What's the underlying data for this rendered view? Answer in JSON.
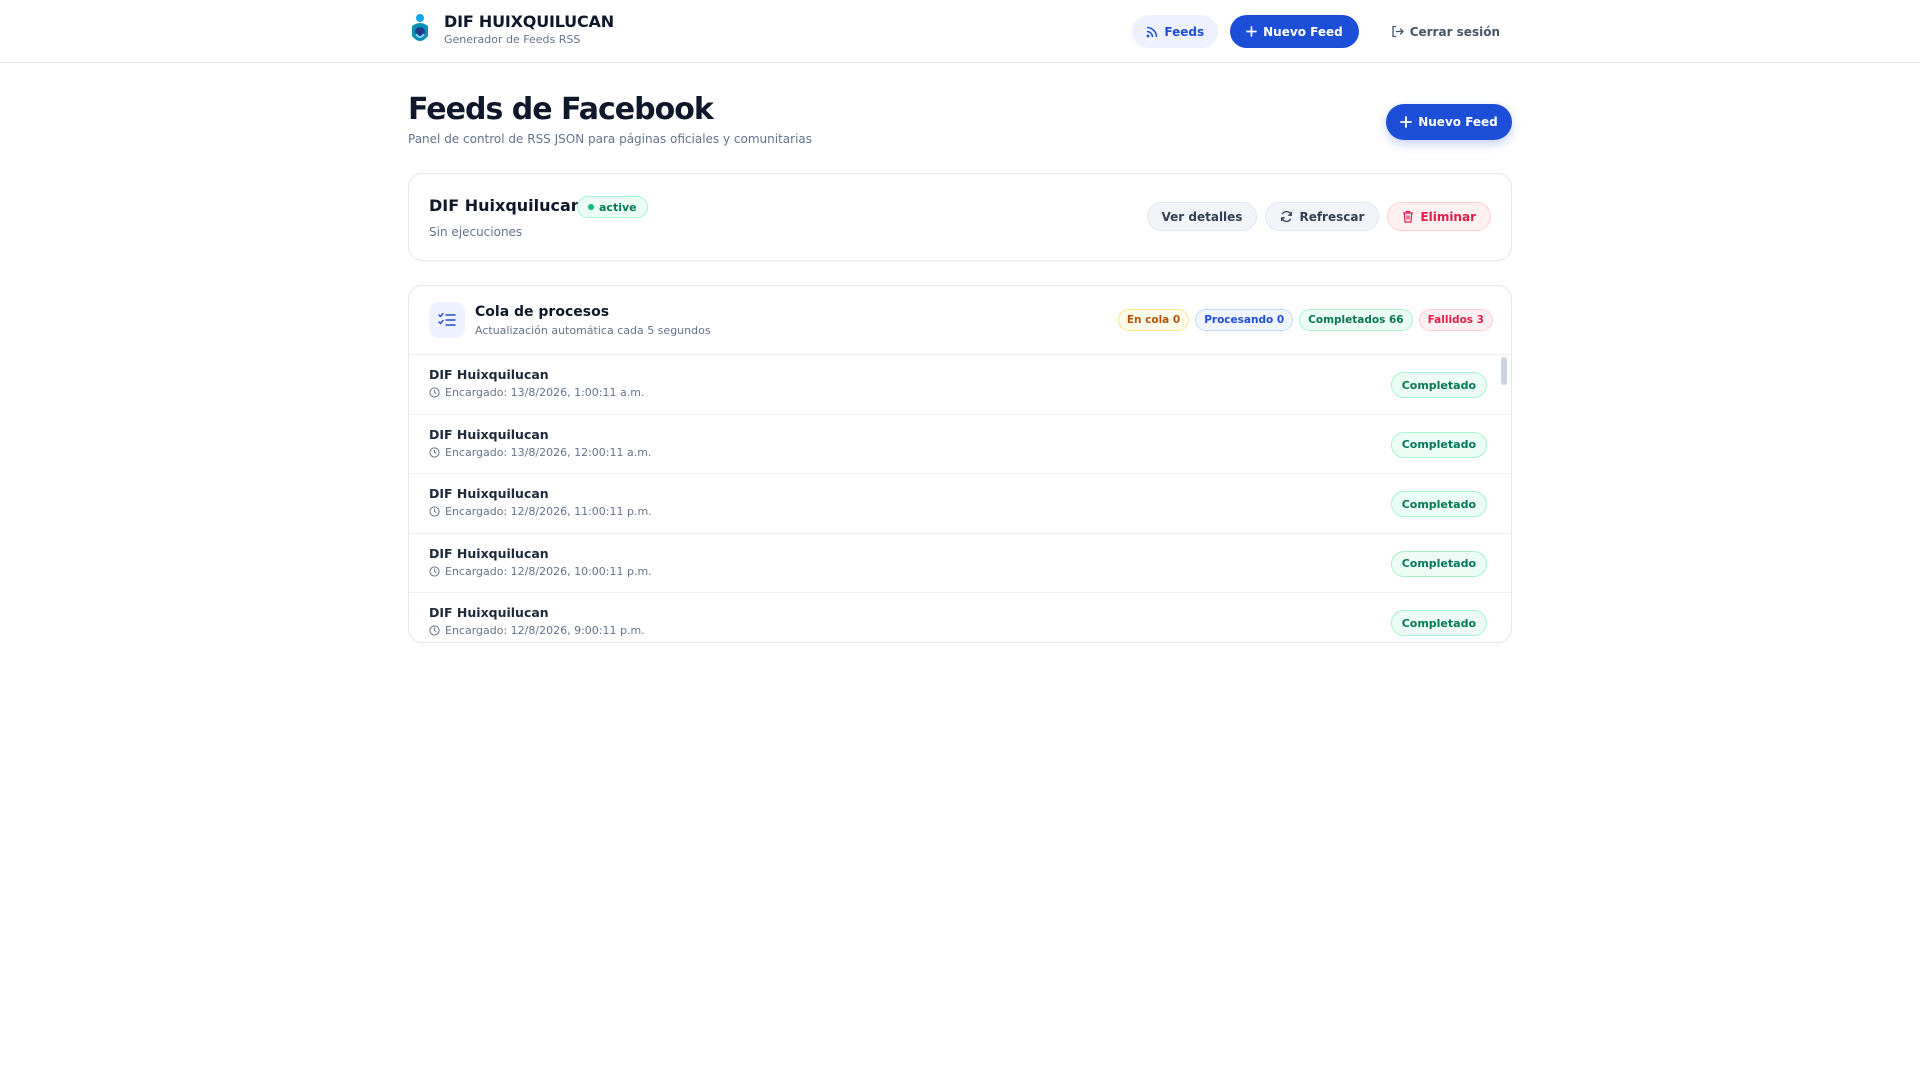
{
  "header": {
    "brand_title": "DIF HUIXQUILUCAN",
    "brand_subtitle": "Generador de Feeds RSS",
    "nav_feeds": "Feeds",
    "nav_new_feed": "Nuevo Feed",
    "nav_logout": "Cerrar sesión"
  },
  "page": {
    "title": "Feeds de Facebook",
    "subtitle": "Panel de control de RSS JSON para páginas oficiales y comunitarias",
    "new_feed_button": "Nuevo Feed"
  },
  "feed": {
    "name": "DIF Huixquilucan",
    "status": "active",
    "meta": "Sin ejecuciones",
    "actions": {
      "details": "Ver detalles",
      "refresh": "Refrescar",
      "delete": "Eliminar"
    }
  },
  "queue": {
    "title": "Cola de procesos",
    "subtitle": "Actualización automática cada 5 segundos",
    "badges": {
      "queued": "En cola 0",
      "processing": "Procesando 0",
      "completed": "Completados 66",
      "failed": "Fallidos 3"
    },
    "items": [
      {
        "name": "DIF Huixquilucan",
        "time": "Encargado: 13/8/2026, 1:00:11 a.m.",
        "status": "Completado"
      },
      {
        "name": "DIF Huixquilucan",
        "time": "Encargado: 13/8/2026, 12:00:11 a.m.",
        "status": "Completado"
      },
      {
        "name": "DIF Huixquilucan",
        "time": "Encargado: 12/8/2026, 11:00:11 p.m.",
        "status": "Completado"
      },
      {
        "name": "DIF Huixquilucan",
        "time": "Encargado: 12/8/2026, 10:00:11 p.m.",
        "status": "Completado"
      },
      {
        "name": "DIF Huixquilucan",
        "time": "Encargado: 12/8/2026, 9:00:11 p.m.",
        "status": "Completado"
      }
    ]
  },
  "colors": {
    "primary": "#1d4ed8",
    "success": "#047857",
    "danger": "#e11d48",
    "warning": "#b45309"
  },
  "icons": [
    "logo-icon",
    "rss-icon",
    "plus-icon",
    "logout-icon",
    "refresh-icon",
    "trash-icon",
    "list-check-icon",
    "clock-icon"
  ]
}
